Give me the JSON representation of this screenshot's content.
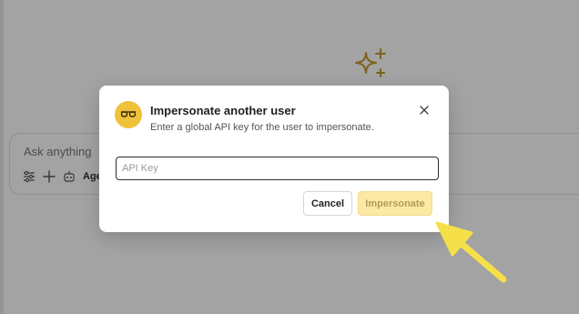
{
  "background": {
    "chat_placeholder": "Ask anything",
    "agent_label": "Agen",
    "icons": [
      "sparkle-icon",
      "sliders-icon",
      "plus-icon",
      "robot-icon"
    ]
  },
  "modal": {
    "title": "Impersonate another user",
    "description": "Enter a global API key for the user to impersonate.",
    "input_placeholder": "API Key",
    "input_value": "",
    "cancel_label": "Cancel",
    "impersonate_label": "Impersonate",
    "icon": "glasses-icon",
    "close_icon": "close-icon"
  },
  "colors": {
    "accent": "#f0c23b",
    "disabled_button_bg": "#fbe9a4",
    "disabled_button_text": "#b49b5a",
    "annotation_arrow": "#f6e04a",
    "overlay": "rgba(0,0,0,0.36)"
  }
}
